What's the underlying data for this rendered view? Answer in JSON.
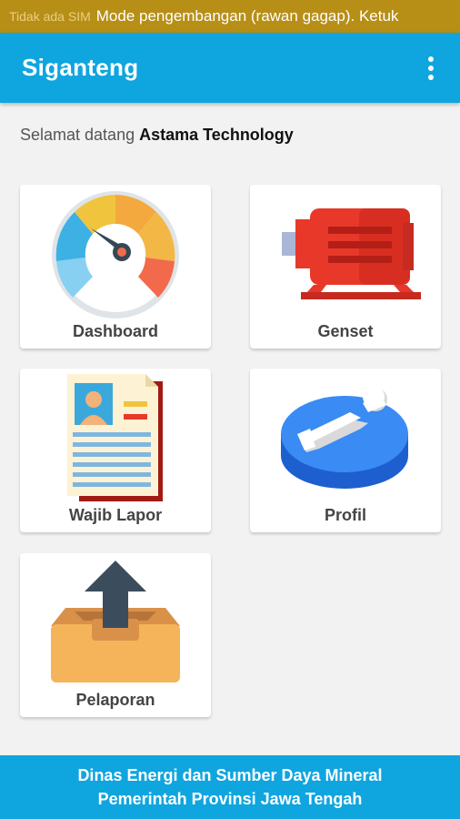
{
  "status_bar": {
    "sim_text": "Tidak ada SIM",
    "ticker_text": "Mode pengembangan (rawan gagap). Ketuk"
  },
  "app_bar": {
    "title": "Siganteng",
    "menu_icon": "more-vert-icon"
  },
  "welcome": {
    "prefix": "Selamat datang",
    "name": "Astama Technology"
  },
  "menu": {
    "items": [
      {
        "label": "Dashboard",
        "icon": "speedometer-icon"
      },
      {
        "label": "Genset",
        "icon": "generator-icon"
      },
      {
        "label": "Wajib Lapor",
        "icon": "report-document-icon"
      },
      {
        "label": "Profil",
        "icon": "profile-disc-icon"
      },
      {
        "label": "Pelaporan",
        "icon": "upload-box-icon"
      }
    ]
  },
  "footer": {
    "line1": "Dinas Energi dan Sumber Daya Mineral",
    "line2": "Pemerintah Provinsi Jawa Tengah"
  },
  "colors": {
    "primary": "#0fa5df",
    "status_bar": "#b78f17",
    "background": "#f2f2f2"
  }
}
